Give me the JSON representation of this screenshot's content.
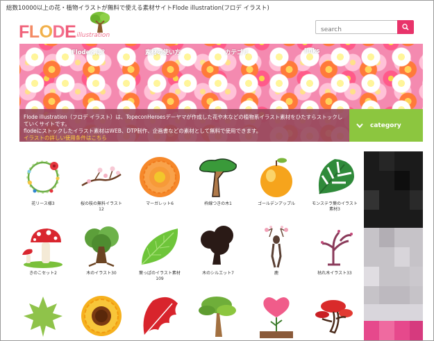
{
  "page": {
    "title": "総数10000以上の花・植物イラストが無料で使える素材サイトFlode illustration(フロデ イラスト)"
  },
  "logo": {
    "main": "FLODE",
    "sub": "illustration",
    "tree_color": "#7cc23a",
    "trunk_color": "#8a5a2b"
  },
  "search": {
    "placeholder": "search",
    "button_color": "#e8336a"
  },
  "nav": {
    "items": [
      "Flodeとは？",
      "素材の使い方",
      "カテゴリ",
      "links"
    ]
  },
  "banner": {
    "description": "Flode illustration（フロデ イラスト）は、TopeconHeroesデーヤマが作成した花や木などの植物系イラスト素材をひたすらストックしていくサイトです。",
    "description2": "flodeにストックしたイラスト素材はWEB、DTP制作、企画書などの素材として無料で使用できます。",
    "link": "イラストの詳しい使用条件はこちら",
    "category_label": "category",
    "category_color": "#8cc63f"
  },
  "illustrations": [
    {
      "label": "花リース様3",
      "icon": "wreath-icon"
    },
    {
      "label": "桜の枝の無料イラスト12",
      "icon": "cherry-branch-icon"
    },
    {
      "label": "マーガレット6",
      "icon": "orange-flower-icon"
    },
    {
      "label": "枠線つきの木1",
      "icon": "outlined-tree-icon"
    },
    {
      "label": "ゴールデンアップル",
      "icon": "golden-apple-icon"
    },
    {
      "label": "モンステラ葉のイラスト素材3",
      "icon": "monstera-leaf-icon"
    },
    {
      "label": "きのこセット2",
      "icon": "mushroom-icon"
    },
    {
      "label": "木のイラスト30",
      "icon": "green-tree-icon"
    },
    {
      "label": "葉っぱのイラスト素材109",
      "icon": "leaf-icon"
    },
    {
      "label": "木のシルエット7",
      "icon": "tree-silhouette-icon"
    },
    {
      "label": "鹿",
      "icon": "deer-icon"
    },
    {
      "label": "枯れ木イラスト33",
      "icon": "bare-tree-icon"
    },
    {
      "label": "",
      "icon": "maple-leaf-icon"
    },
    {
      "label": "",
      "icon": "sunflower-icon"
    },
    {
      "label": "",
      "icon": "red-leaf-icon"
    },
    {
      "label": "",
      "icon": "bonsai-tree-icon"
    },
    {
      "label": "",
      "icon": "heart-plant-icon"
    },
    {
      "label": "",
      "icon": "red-tree-icon"
    }
  ]
}
